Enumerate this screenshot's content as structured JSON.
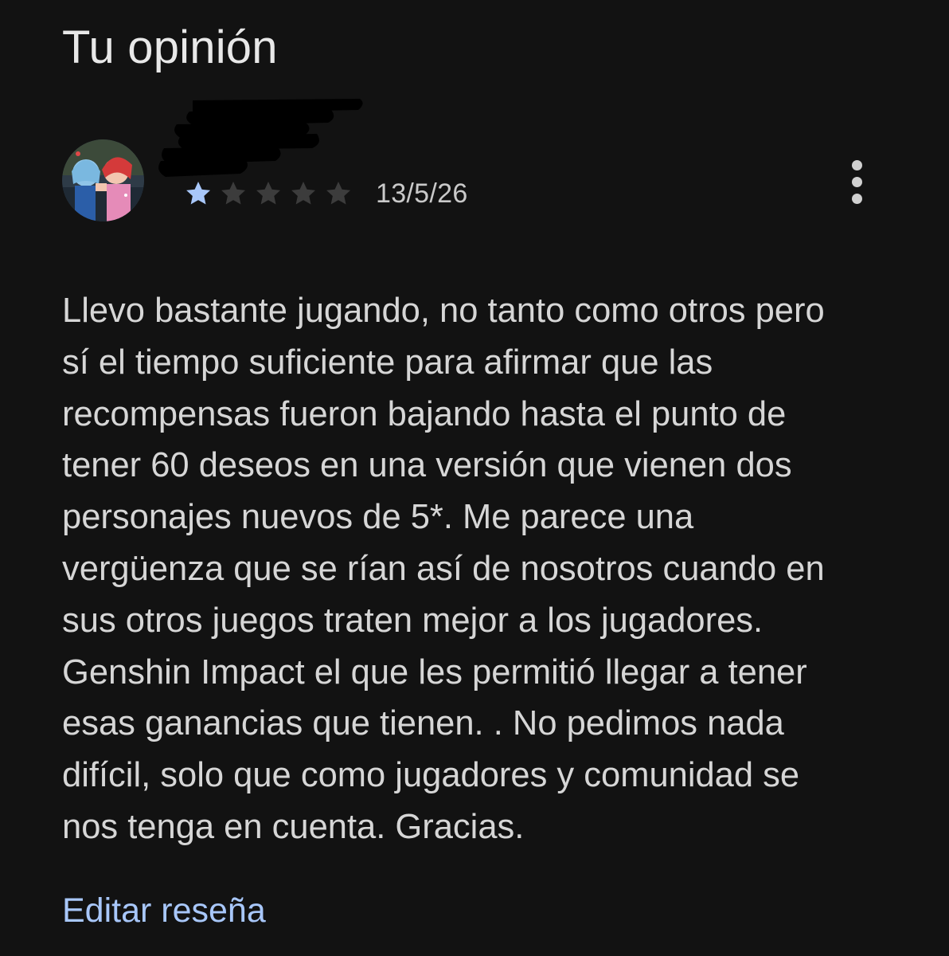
{
  "section": {
    "title": "Tu opinión"
  },
  "review": {
    "rating": 1,
    "max_rating": 5,
    "date": "13/5/26",
    "body": "Llevo bastante jugando, no tanto como otros pero\nsí el tiempo suficiente para afirmar que las\nrecompensas fueron bajando hasta el punto de\ntener 60 deseos en una versión que vienen dos\npersonajes nuevos de 5*. Me parece una\nvergüenza que se rían así de nosotros cuando en\nsus otros juegos traten mejor a los jugadores.\nGenshin Impact el que les permitió llegar a tener\nesas ganancias que tienen. . No pedimos nada\ndifícil, solo que como jugadores y comunidad se\nnos tenga en cuenta. Gracias.",
    "edit_label": "Editar reseña"
  },
  "icons": {
    "star_filled": "star-filled-icon",
    "star_empty": "star-empty-icon",
    "more": "more-vertical-icon"
  },
  "colors": {
    "background": "#121212",
    "star_filled": "#a8c7fa",
    "star_empty": "#3c3c3c",
    "link": "#a8c7fa"
  }
}
